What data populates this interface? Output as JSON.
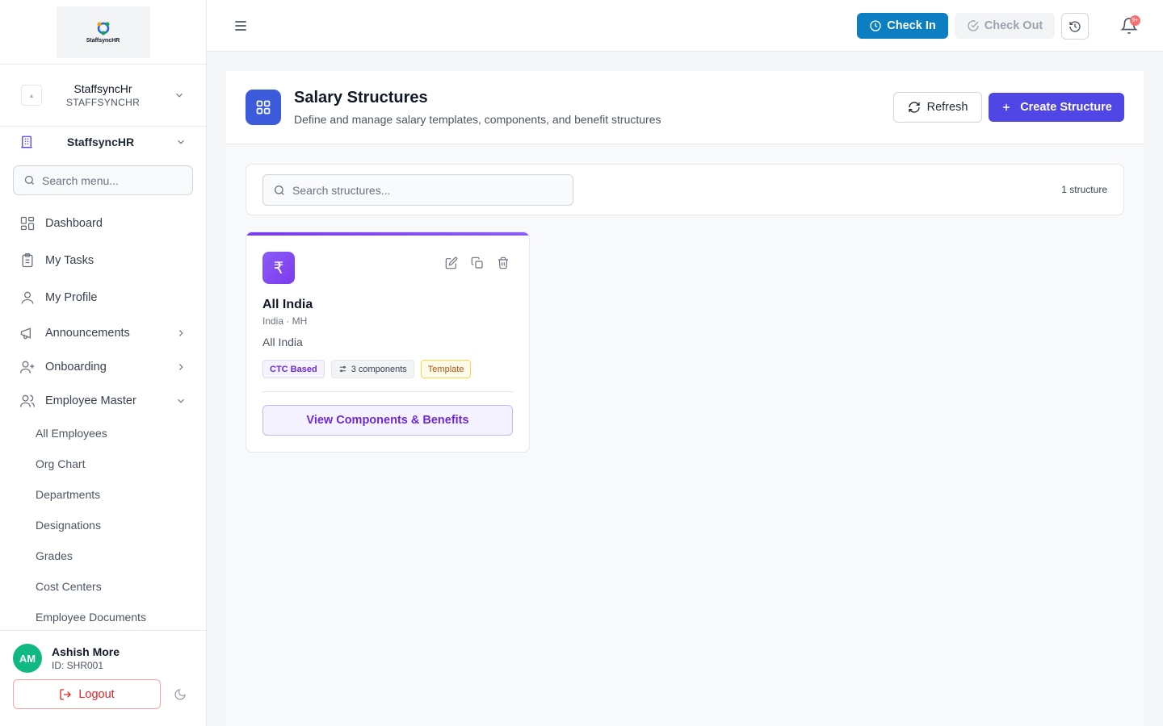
{
  "brand": {
    "logo_text": "StaffsyncHR"
  },
  "org_switcher": {
    "name": "StaffsyncHr",
    "code": "STAFFSYNCHR"
  },
  "company": {
    "name": "StaffsyncHR"
  },
  "menu_search": {
    "placeholder": "Search menu..."
  },
  "nav": {
    "dashboard": "Dashboard",
    "my_tasks": "My Tasks",
    "my_profile": "My Profile",
    "announcements": "Announcements",
    "onboarding": "Onboarding",
    "employee_master": "Employee Master",
    "sub": [
      "All Employees",
      "Org Chart",
      "Departments",
      "Designations",
      "Grades",
      "Cost Centers",
      "Employee Documents"
    ]
  },
  "user": {
    "initials": "AM",
    "name": "Ashish More",
    "id": "ID: SHR001",
    "logout": "Logout"
  },
  "topbar": {
    "check_in": "Check In",
    "check_out": "Check Out",
    "notification_badge": "9+"
  },
  "page": {
    "title": "Salary Structures",
    "subtitle": "Define and manage salary templates, components, and benefit structures",
    "refresh": "Refresh",
    "create": "Create Structure",
    "search_placeholder": "Search structures...",
    "count": "1 structure"
  },
  "structures": [
    {
      "icon": "₹",
      "name": "All India",
      "location": "India · MH",
      "description": "All India",
      "tags": [
        "CTC Based",
        "3 components",
        "Template"
      ],
      "view_label": "View Components & Benefits"
    }
  ],
  "colors": {
    "primary": "#4f46e5",
    "check_in": "#0b7fc1",
    "accent_purple": "#7c3aed",
    "avatar": "#10b981"
  }
}
